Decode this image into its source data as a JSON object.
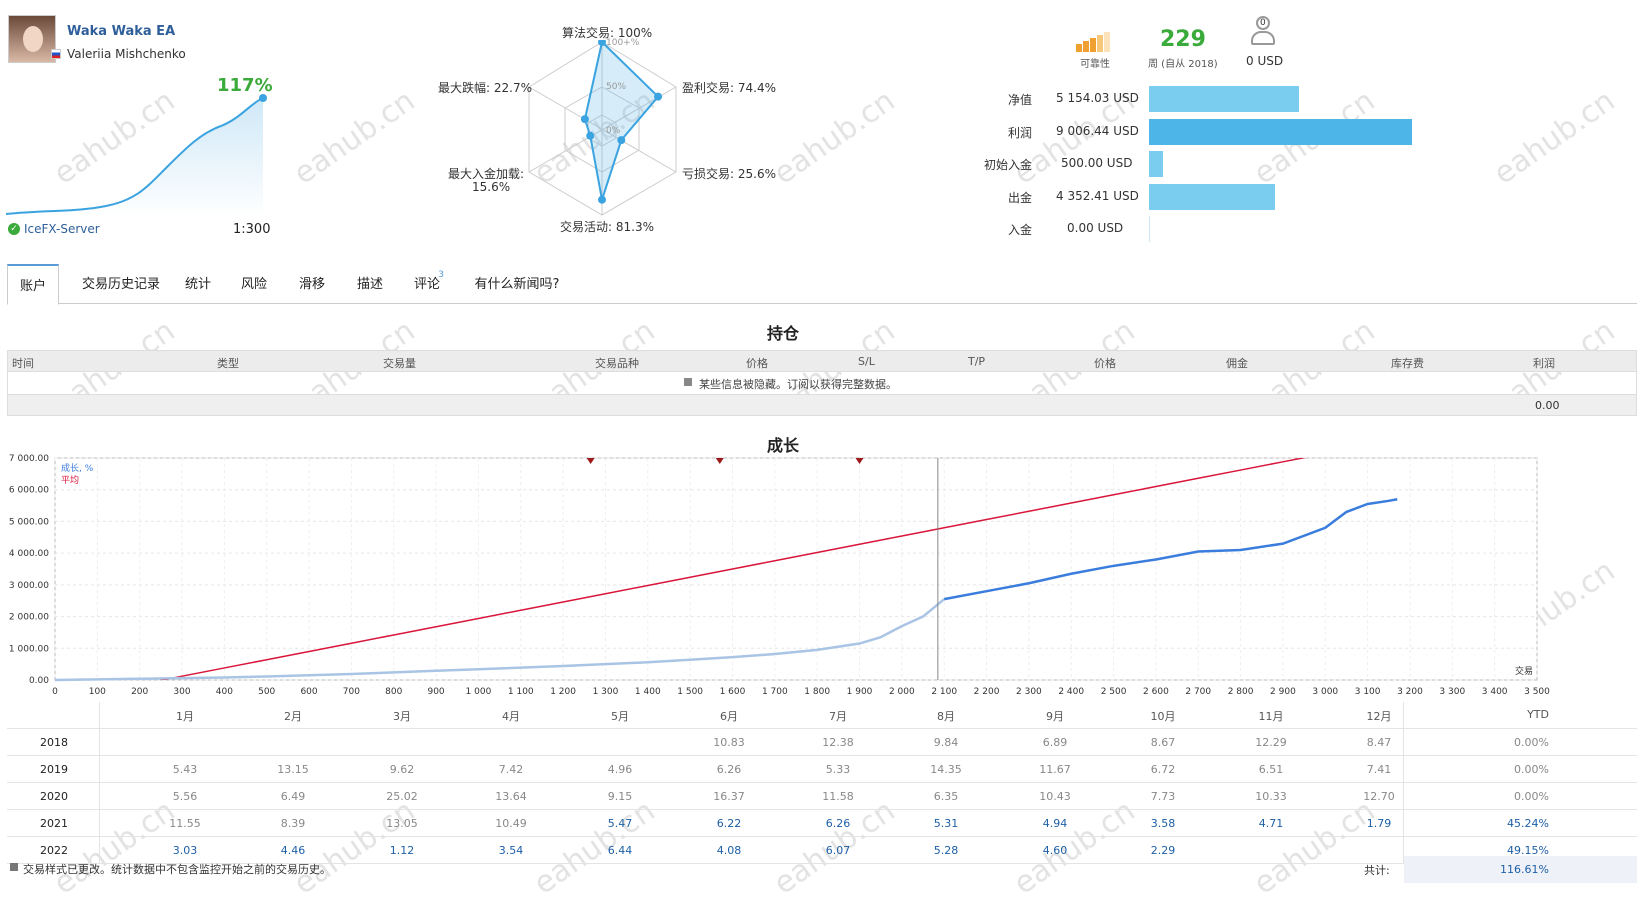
{
  "profile": {
    "ea_name": "Waka Waka EA",
    "author": "Valeriia Mishchenko",
    "growth_pct": "117%",
    "server": "IceFX-Server",
    "leverage": "1:300"
  },
  "radar": {
    "algo": "算法交易: 100%",
    "profit_trades": "盈利交易: 74.4%",
    "loss_trades": "亏损交易: 25.6%",
    "activity": "交易活动: 81.3%",
    "max_deposit_load": "最大入金加载:",
    "max_deposit_load_val": "15.6%",
    "max_drawdown": "最大跌幅: 22.7%",
    "scale_100": "100+%",
    "scale_50": "50%",
    "scale_0": "0%",
    "values": [
      100,
      74.4,
      25.6,
      81.3,
      15.6,
      22.7
    ]
  },
  "stats": {
    "reliability_label": "可靠性",
    "weeks_value": "229",
    "weeks_label": "周 (自从 2018)",
    "subscribers_count": "0",
    "subscribers_value": "0 USD",
    "rows": [
      {
        "label": "净值",
        "value": "5 154.03 USD",
        "fraction": 0.57
      },
      {
        "label": "利润",
        "value": "9 006.44 USD",
        "fraction": 1.0
      },
      {
        "label": "初始入金",
        "value": "500.00 USD",
        "fraction": 0.055
      },
      {
        "label": "出金",
        "value": "4 352.41 USD",
        "fraction": 0.48
      },
      {
        "label": "入金",
        "value": "0.00 USD",
        "fraction": 0.0
      }
    ]
  },
  "tabs": [
    "账户",
    "交易历史记录",
    "统计",
    "风险",
    "滑移",
    "描述",
    "评论",
    "有什么新闻吗?"
  ],
  "comments_badge": "3",
  "positions": {
    "title": "持仓",
    "columns": [
      "时间",
      "类型",
      "交易量",
      "交易品种",
      "价格",
      "S/L",
      "T/P",
      "价格",
      "佣金",
      "库存费",
      "利润"
    ],
    "hidden_notice": "某些信息被隐藏。订阅以获得完整数据。",
    "total": "0.00"
  },
  "growth": {
    "title": "成长",
    "legend_growth": "成长, %",
    "legend_avg": "平均",
    "x_axis_label": "交易",
    "y_ticks": [
      "7 000.00",
      "6 000.00",
      "5 000.00",
      "4 000.00",
      "3 000.00",
      "2 000.00",
      "1 000.00",
      "0.00"
    ],
    "x_ticks": [
      "0",
      "100",
      "200",
      "300",
      "400",
      "500",
      "600",
      "700",
      "800",
      "900",
      "1 000",
      "1 100",
      "1 200",
      "1 300",
      "1 400",
      "1 500",
      "1 600",
      "1 700",
      "1 800",
      "1 900",
      "2 000",
      "2 100",
      "2 200",
      "2 300",
      "2 400",
      "2 500",
      "2 600",
      "2 700",
      "2 800",
      "2 900",
      "3 000",
      "3 100",
      "3 200",
      "3 300",
      "3 400",
      "3 500"
    ]
  },
  "chart_data": {
    "type": "line",
    "x": [
      0,
      100,
      200,
      300,
      400,
      500,
      600,
      700,
      800,
      900,
      1000,
      1100,
      1200,
      1300,
      1400,
      1500,
      1600,
      1700,
      1800,
      1900,
      1950,
      2000,
      2050,
      2100,
      2200,
      2300,
      2400,
      2500,
      2600,
      2700,
      2800,
      2900,
      3000,
      3050,
      3100,
      3150,
      3170
    ],
    "series": [
      {
        "name": "成长, %",
        "values": [
          0,
          20,
          40,
          60,
          80,
          110,
          150,
          190,
          240,
          290,
          340,
          390,
          440,
          500,
          560,
          640,
          720,
          820,
          950,
          1150,
          1350,
          1700,
          2000,
          2550,
          2800,
          3050,
          3350,
          3600,
          3800,
          4050,
          4100,
          4300,
          4800,
          5300,
          5550,
          5650,
          5700
        ]
      },
      {
        "name": "平均",
        "values": [
          -650,
          -400,
          -150,
          120,
          380,
          640,
          900,
          1160,
          1420,
          1680,
          1940,
          2200,
          2460,
          2720,
          2980,
          3240,
          3500,
          3760,
          4020,
          4280,
          4410,
          4540,
          4670,
          4800,
          5060,
          5320,
          5580,
          5840,
          6100,
          6360,
          6620,
          6880,
          7140,
          7270,
          7400,
          7530,
          7590
        ]
      }
    ],
    "xlabel": "交易",
    "ylim": [
      0,
      7000
    ],
    "xlim": [
      0,
      3500
    ]
  },
  "returns": {
    "months": [
      "1月",
      "2月",
      "3月",
      "4月",
      "5月",
      "6月",
      "7月",
      "8月",
      "9月",
      "10月",
      "11月",
      "12月"
    ],
    "ytd_label": "YTD",
    "rows": [
      {
        "year": "2018",
        "vals": [
          "",
          "",
          "",
          "",
          "",
          "10.83",
          "12.38",
          "9.84",
          "6.89",
          "8.67",
          "12.29",
          "8.47"
        ],
        "ytd": "0.00%"
      },
      {
        "year": "2019",
        "vals": [
          "5.43",
          "13.15",
          "9.62",
          "7.42",
          "4.96",
          "6.26",
          "5.33",
          "14.35",
          "11.67",
          "6.72",
          "6.51",
          "7.41"
        ],
        "ytd": "0.00%"
      },
      {
        "year": "2020",
        "vals": [
          "5.56",
          "6.49",
          "25.02",
          "13.64",
          "9.15",
          "16.37",
          "11.58",
          "6.35",
          "10.43",
          "7.73",
          "10.33",
          "12.70"
        ],
        "ytd": "0.00%"
      },
      {
        "year": "2021",
        "vals": [
          "11.55",
          "8.39",
          "13.05",
          "10.49",
          "5.47",
          "6.22",
          "6.26",
          "5.31",
          "4.94",
          "3.58",
          "4.71",
          "1.79"
        ],
        "ytd": "45.24%"
      },
      {
        "year": "2022",
        "vals": [
          "3.03",
          "4.46",
          "1.12",
          "3.54",
          "6.44",
          "4.08",
          "6.07",
          "5.28",
          "4.60",
          "2.29",
          "",
          ""
        ],
        "ytd": "49.15%"
      }
    ],
    "footer_note": "交易样式已更改。统计数据中不包含监控开始之前的交易历史。",
    "total_label": "共计:",
    "total_value": "116.61%"
  },
  "watermark": "eahub.cn",
  "colors": {
    "accent_green": "#3aaa3a",
    "link_blue": "#1d5fa7",
    "bar": "#7bcdf0",
    "bar_dark": "#4db5e8",
    "growth_line": "#3b7ddd",
    "avg_line": "#d9163a"
  }
}
